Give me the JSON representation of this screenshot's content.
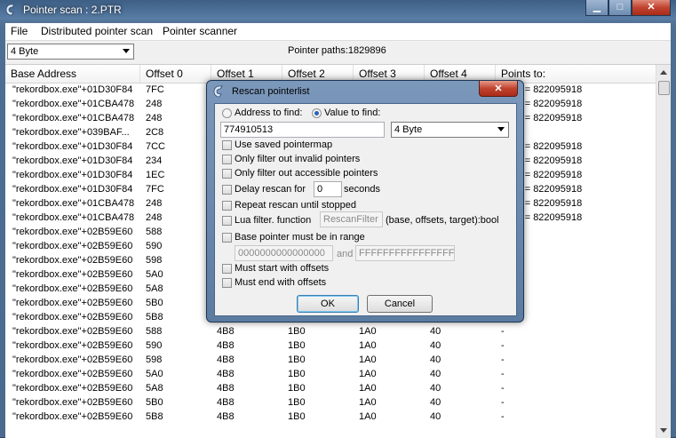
{
  "window": {
    "title": "Pointer scan : 2.PTR"
  },
  "menu": [
    "File",
    "Distributed pointer scan",
    "Pointer scanner"
  ],
  "toolbar": {
    "type_value": "4 Byte",
    "pointer_paths": "Pointer paths:1829896"
  },
  "columns": [
    "Base Address",
    "Offset 0",
    "Offset 1",
    "Offset 2",
    "Offset 3",
    "Offset 4",
    "Points to:"
  ],
  "rows": [
    [
      "\"rekordbox.exe\"+01D30F84",
      "7FC",
      "",
      "",
      "",
      "",
      "7110 = 822095918"
    ],
    [
      "\"rekordbox.exe\"+01CBA478",
      "248",
      "",
      "",
      "",
      "",
      "7110 = 822095918"
    ],
    [
      "\"rekordbox.exe\"+01CBA478",
      "248",
      "",
      "",
      "",
      "",
      "7110 = 822095918"
    ],
    [
      "\"rekordbox.exe\"+039BAF...",
      "2C8",
      "",
      "",
      "",
      "",
      ""
    ],
    [
      "\"rekordbox.exe\"+01D30F84",
      "7CC",
      "",
      "",
      "",
      "",
      "7110 = 822095918"
    ],
    [
      "\"rekordbox.exe\"+01D30F84",
      "234",
      "",
      "",
      "",
      "",
      "7110 = 822095918"
    ],
    [
      "\"rekordbox.exe\"+01D30F84",
      "1EC",
      "",
      "",
      "",
      "",
      "7110 = 822095918"
    ],
    [
      "\"rekordbox.exe\"+01D30F84",
      "7FC",
      "",
      "",
      "",
      "",
      "7110 = 822095918"
    ],
    [
      "\"rekordbox.exe\"+01CBA478",
      "248",
      "",
      "",
      "",
      "",
      "7110 = 822095918"
    ],
    [
      "\"rekordbox.exe\"+01CBA478",
      "248",
      "",
      "",
      "",
      "",
      "7110 = 822095918"
    ],
    [
      "\"rekordbox.exe\"+02B59E60",
      "588",
      "",
      "",
      "",
      "",
      ""
    ],
    [
      "\"rekordbox.exe\"+02B59E60",
      "590",
      "",
      "",
      "",
      "",
      ""
    ],
    [
      "\"rekordbox.exe\"+02B59E60",
      "598",
      "",
      "",
      "",
      "",
      ""
    ],
    [
      "\"rekordbox.exe\"+02B59E60",
      "5A0",
      "",
      "",
      "",
      "",
      ""
    ],
    [
      "\"rekordbox.exe\"+02B59E60",
      "5A8",
      "",
      "",
      "",
      "",
      ""
    ],
    [
      "\"rekordbox.exe\"+02B59E60",
      "5B0",
      "",
      "",
      "",
      "",
      ""
    ],
    [
      "\"rekordbox.exe\"+02B59E60",
      "5B8",
      "",
      "",
      "",
      "",
      ""
    ],
    [
      "\"rekordbox.exe\"+02B59E60",
      "588",
      "4B8",
      "1B0",
      "1A0",
      "40",
      "-"
    ],
    [
      "\"rekordbox.exe\"+02B59E60",
      "590",
      "4B8",
      "1B0",
      "1A0",
      "40",
      "-"
    ],
    [
      "\"rekordbox.exe\"+02B59E60",
      "598",
      "4B8",
      "1B0",
      "1A0",
      "40",
      "-"
    ],
    [
      "\"rekordbox.exe\"+02B59E60",
      "5A0",
      "4B8",
      "1B0",
      "1A0",
      "40",
      "-"
    ],
    [
      "\"rekordbox.exe\"+02B59E60",
      "5A8",
      "4B8",
      "1B0",
      "1A0",
      "40",
      "-"
    ],
    [
      "\"rekordbox.exe\"+02B59E60",
      "5B0",
      "4B8",
      "1B0",
      "1A0",
      "40",
      "-"
    ],
    [
      "\"rekordbox.exe\"+02B59E60",
      "5B8",
      "4B8",
      "1B0",
      "1A0",
      "40",
      "-"
    ]
  ],
  "dialog": {
    "title": "Rescan pointerlist",
    "address_label": "Address to find:",
    "value_label": "Value to find:",
    "value_input": "774910513",
    "type_select": "4 Byte",
    "use_saved": "Use saved pointermap",
    "filter_invalid": "Only filter out invalid pointers",
    "filter_accessible": "Only filter out accessible pointers",
    "delay_label": "Delay rescan for",
    "delay_value": "0",
    "delay_unit": "seconds",
    "repeat": "Repeat rescan until stopped",
    "lua_label": "Lua filter. function",
    "lua_func": "RescanFilter",
    "lua_args": "(base, offsets, target):bool",
    "base_range": "Base pointer must be in range",
    "range_from": "0000000000000000",
    "range_and": "and",
    "range_to": "FFFFFFFFFFFFFFFF",
    "must_start": "Must start with offsets",
    "must_end": "Must end with offsets",
    "ok": "OK",
    "cancel": "Cancel"
  }
}
